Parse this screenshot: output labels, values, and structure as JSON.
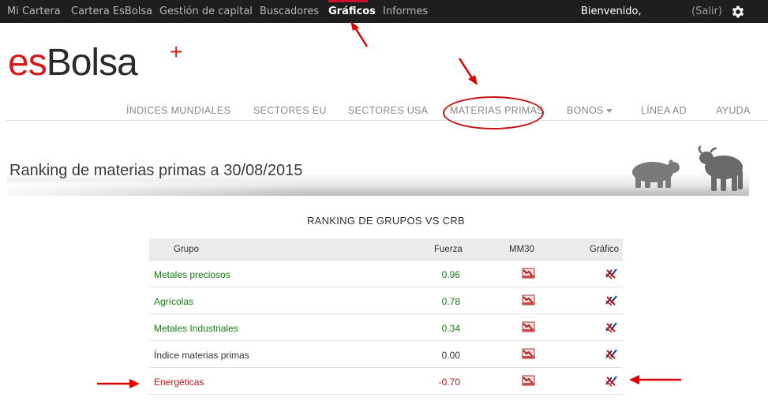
{
  "topnav": {
    "items": [
      {
        "label": "Mi Cartera"
      },
      {
        "label": "Cartera EsBolsa"
      },
      {
        "label": "Gestión de capital"
      },
      {
        "label": "Buscadores"
      },
      {
        "label": "Gráficos",
        "active": true
      },
      {
        "label": "Informes"
      }
    ],
    "welcome": "Bienvenido,",
    "logout": "(Salir)",
    "settings_icon": "gear-icon"
  },
  "logo": {
    "part1": "es",
    "part2": "Bolsa",
    "plus": "+"
  },
  "mainnav": {
    "items": [
      {
        "label": "ÍNDICES MUNDIALES"
      },
      {
        "label": "SECTORES EU"
      },
      {
        "label": "SECTORES USA"
      },
      {
        "label": "MATERIAS PRIMAS",
        "highlighted": true
      },
      {
        "label": "BONOS",
        "dropdown": true
      },
      {
        "label": "LÍNEA AD"
      },
      {
        "label": "AYUDA"
      }
    ]
  },
  "banner": {
    "title": "Ranking de materias primas a 30/08/2015"
  },
  "ranking": {
    "title": "RANKING DE GRUPOS VS CRB",
    "columns": {
      "group": "Grupo",
      "strength": "Fuerza",
      "mm30": "MM30",
      "chart": "Gráfico"
    },
    "rows": [
      {
        "group": "Metales preciosos",
        "strength": "0.96",
        "color": "#1a7d1a"
      },
      {
        "group": "Agrícolas",
        "strength": "0.78",
        "color": "#1a7d1a"
      },
      {
        "group": "Metales Industriales",
        "strength": "0.34",
        "color": "#1a7d1a"
      },
      {
        "group": "Índice materias primas",
        "strength": "0.00",
        "color": "#333333"
      },
      {
        "group": "Energéticas",
        "strength": "-0.70",
        "color": "#b01e1e"
      }
    ]
  },
  "colors": {
    "topbar_bg": "#1e1e1e",
    "brand_red": "#d41c1c",
    "positive": "#1a7d1a",
    "negative": "#b01e1e",
    "annotation": "#e00000"
  }
}
